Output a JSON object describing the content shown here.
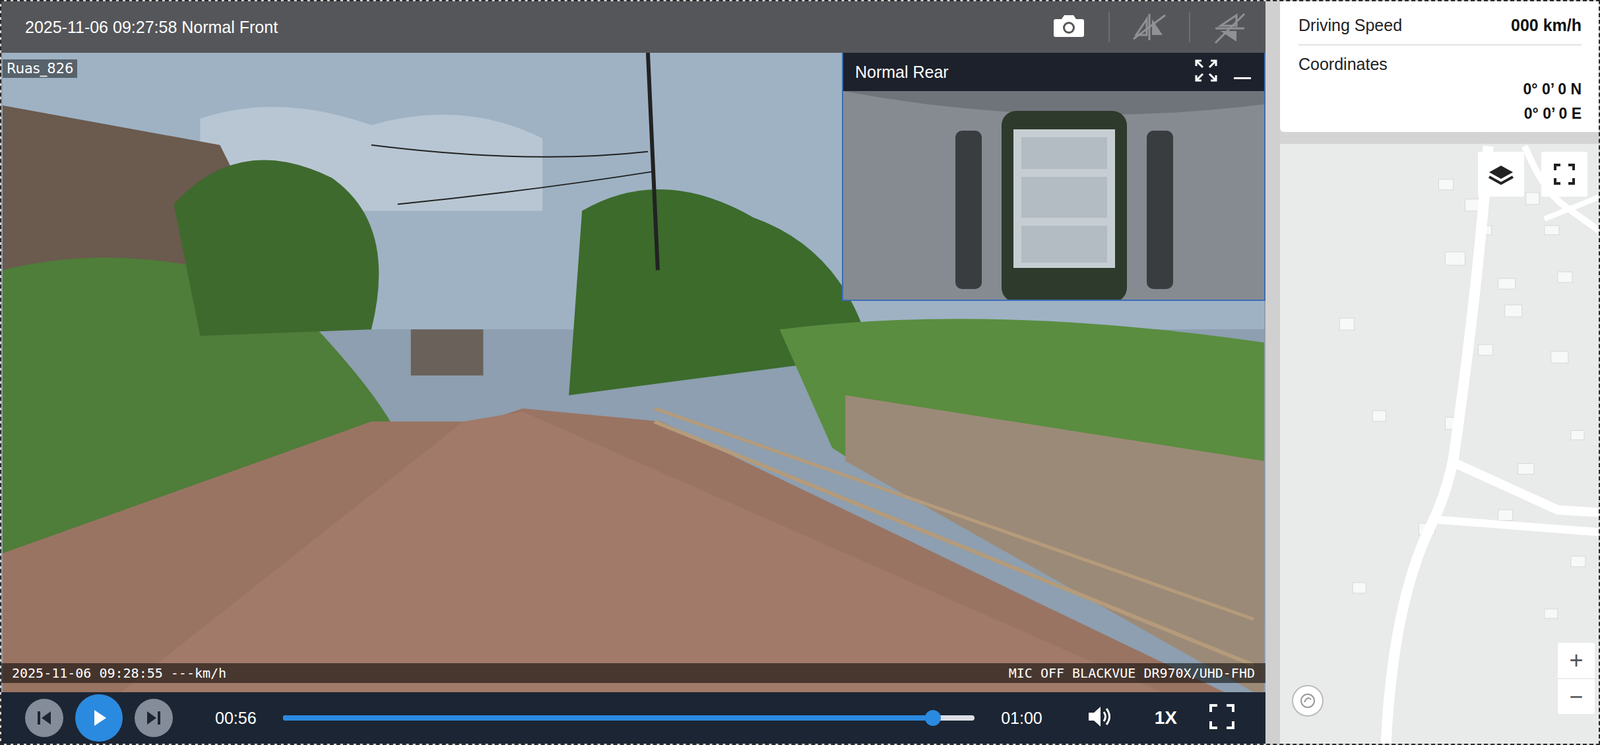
{
  "player": {
    "title": "2025-11-06 09:27:58 Normal Front",
    "toolbar": [
      {
        "kind": "camera",
        "disabled": false
      },
      {
        "kind": "mirror",
        "disabled": true
      },
      {
        "kind": "flip",
        "disabled": true
      }
    ],
    "overlay_label": "Ruas_826",
    "osd_left": "2025-11-06 09:28:55 ---km/h",
    "osd_right": "MIC OFF BLACKVUE DR970X/UHD-FHD"
  },
  "rear_camera": {
    "title": "Normal Rear"
  },
  "controls": {
    "current_time": "00:56",
    "duration": "01:00",
    "level": 0.94,
    "playing": false,
    "speed": "1X"
  },
  "info": {
    "speed_label": "Driving Speed",
    "speed_value": "000 km/h",
    "coords_label": "Coordinates",
    "lat": "0° 0’ 0 N",
    "lon": "0° 0’ 0 E"
  },
  "map": {
    "zoom_in": "+",
    "zoom_out": "−"
  }
}
